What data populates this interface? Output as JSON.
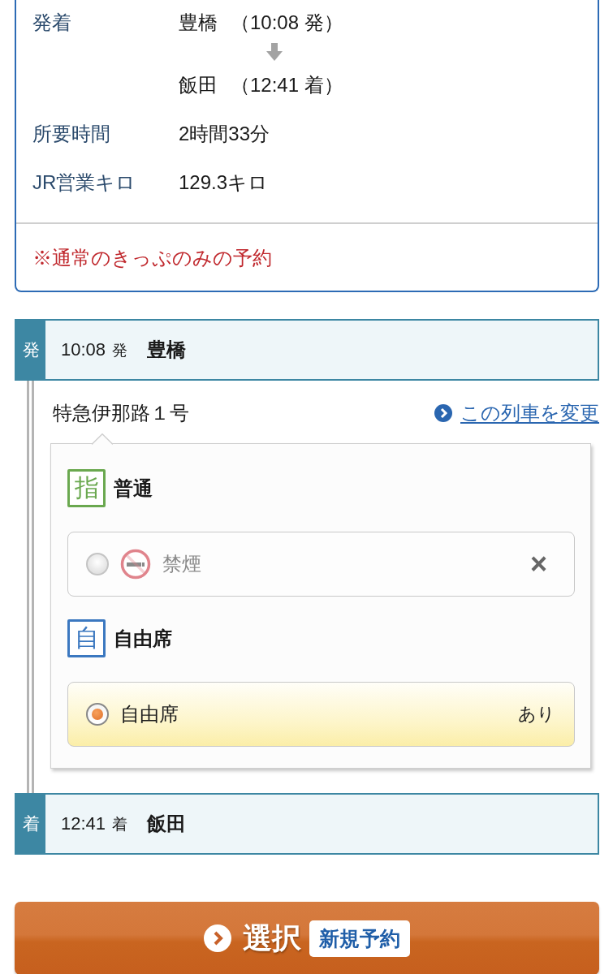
{
  "summary": {
    "rows": [
      {
        "kind": "route",
        "label": "発着",
        "departure": {
          "station": "豊橋",
          "time": "（10:08 発）"
        },
        "arrival": {
          "station": "飯田",
          "time": "（12:41 着）"
        }
      },
      {
        "kind": "text",
        "label": "所要時間",
        "value": "2時間33分"
      },
      {
        "kind": "text",
        "label": "JR営業キロ",
        "value": "129.3キロ"
      }
    ],
    "note": "※通常のきっぷのみの予約"
  },
  "timeline": {
    "departure": {
      "tag": "発",
      "time": "10:08",
      "suffix": "発",
      "station": "豊橋"
    },
    "train": {
      "name": "特急伊那路１号",
      "change_link": "この列車を変更",
      "seat_groups": [
        {
          "badge": "指",
          "color": "#6aa84f",
          "title": "普通",
          "options": [
            {
              "kind": "non_smoking",
              "label": "禁煙",
              "availability": "×",
              "disabled": true,
              "selected": false
            }
          ]
        },
        {
          "badge": "自",
          "color": "#3b78c0",
          "title": "自由席",
          "options": [
            {
              "kind": "plain",
              "label": "自由席",
              "availability": "あり",
              "disabled": false,
              "selected": true
            }
          ]
        }
      ]
    },
    "arrival": {
      "tag": "着",
      "time": "12:41",
      "suffix": "着",
      "station": "飯田"
    }
  },
  "select_button": {
    "label": "選択",
    "badge": "新規予約"
  }
}
